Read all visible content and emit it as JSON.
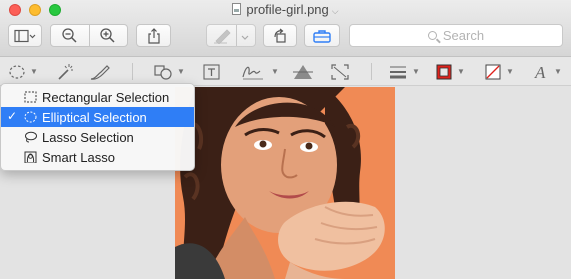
{
  "window": {
    "title": "profile-girl.png"
  },
  "toolbar": {
    "search_placeholder": "Search"
  },
  "selection_menu": {
    "items": [
      {
        "label": "Rectangular Selection",
        "checked": false,
        "icon": "rectangle-dashed-icon"
      },
      {
        "label": "Elliptical Selection",
        "checked": true,
        "icon": "ellipse-dashed-icon"
      },
      {
        "label": "Lasso Selection",
        "checked": false,
        "icon": "lasso-icon"
      },
      {
        "label": "Smart Lasso",
        "checked": false,
        "icon": "smart-lasso-icon"
      }
    ],
    "check_glyph": "✓"
  },
  "colors": {
    "selection_highlight": "#2f7ef6",
    "border_color_swatch": "#e0211b",
    "photo_background": "#f08a55"
  }
}
